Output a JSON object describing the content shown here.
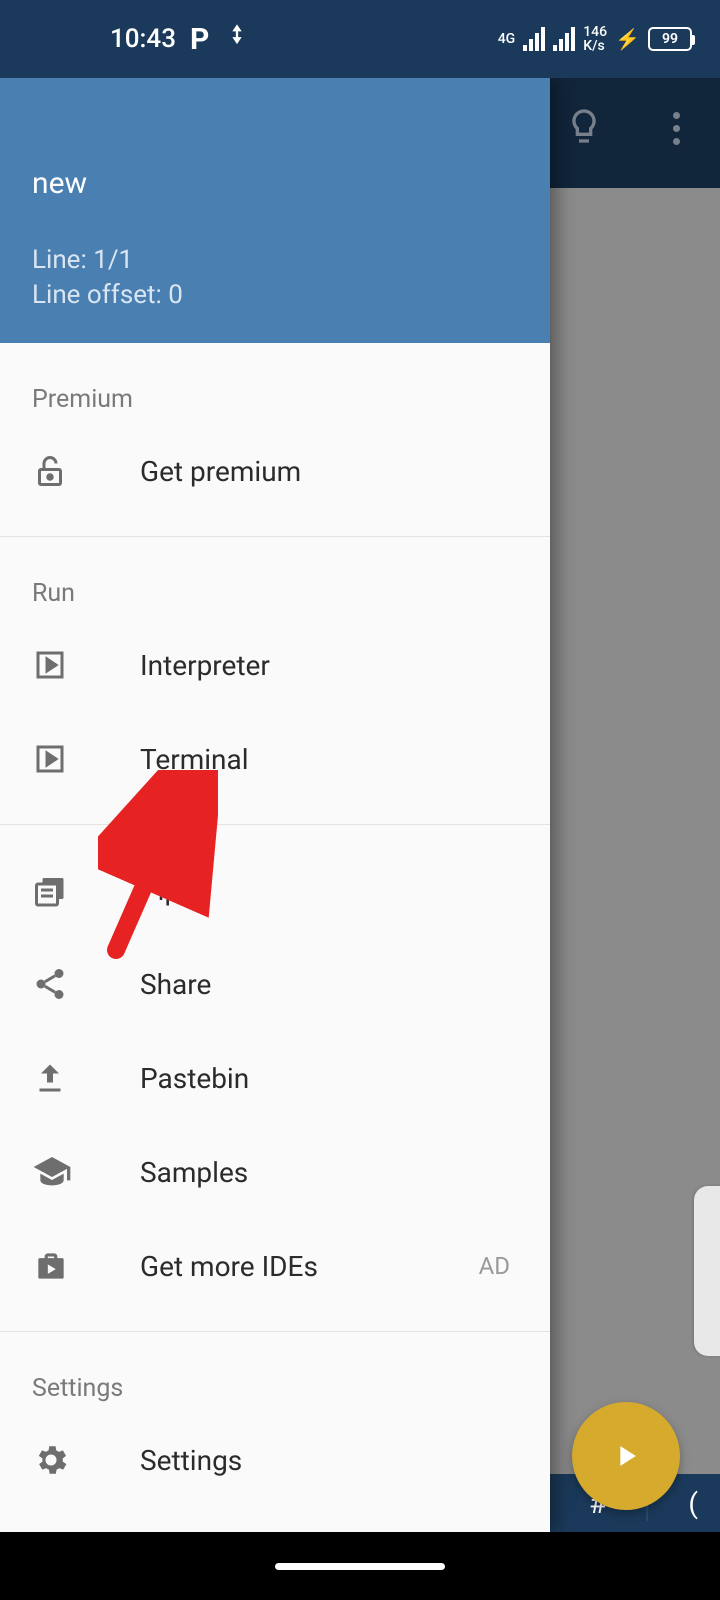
{
  "status": {
    "time": "10:43",
    "network_label": "4G",
    "data_rate_value": "146",
    "data_rate_unit": "K/s",
    "battery": "99"
  },
  "drawer": {
    "title": "new",
    "line_info": "Line: 1/1",
    "offset_info": "Line offset: 0",
    "sections": {
      "premium": {
        "header": "Premium",
        "get_premium": "Get premium"
      },
      "run": {
        "header": "Run",
        "interpreter": "Interpreter",
        "terminal": "Terminal"
      },
      "tools": {
        "pip": "Pip",
        "share": "Share",
        "pastebin": "Pastebin",
        "samples": "Samples",
        "more_ides": "Get more IDEs",
        "ad_label": "AD"
      },
      "settings": {
        "header": "Settings",
        "settings": "Settings"
      }
    }
  },
  "bottom_bar": {
    "hash": "#",
    "paren": "("
  }
}
